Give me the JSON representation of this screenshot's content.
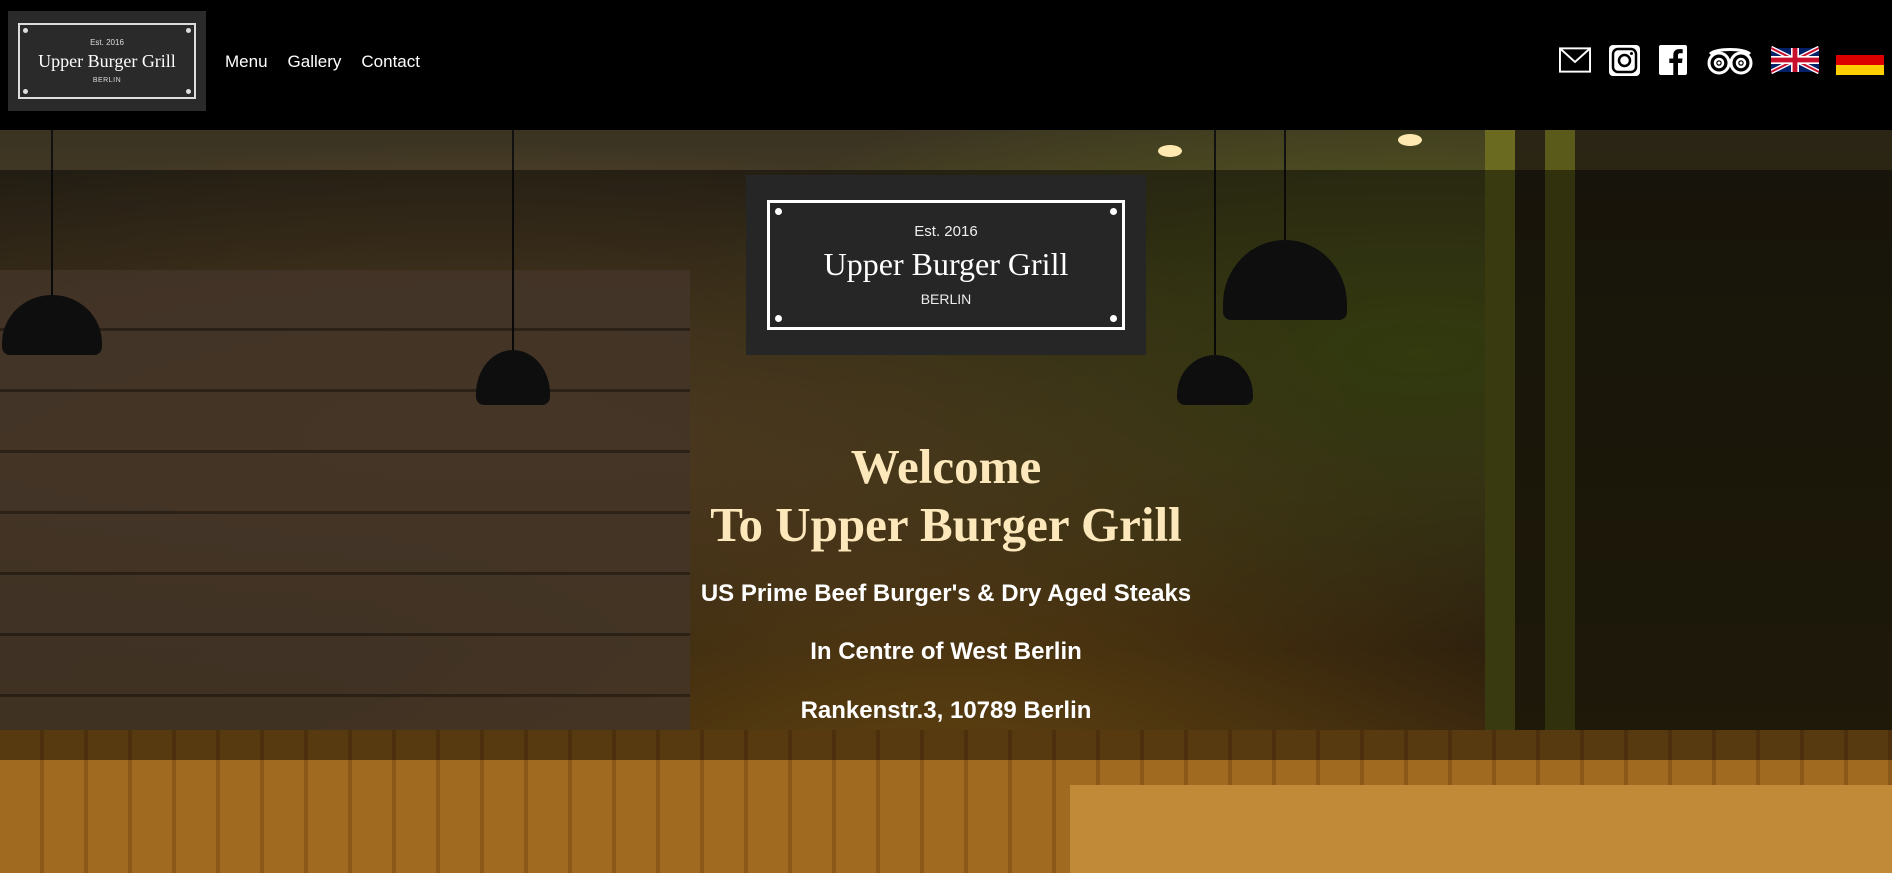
{
  "header": {
    "logo": {
      "est": "Est. 2016",
      "name": "Upper Burger Grill",
      "city": "BERLIN"
    },
    "nav": [
      {
        "label": "Menu"
      },
      {
        "label": "Gallery"
      },
      {
        "label": "Contact"
      }
    ],
    "icons": [
      "email-icon",
      "instagram-icon",
      "facebook-icon",
      "tripadvisor-icon",
      "uk-flag-icon",
      "german-flag-icon"
    ]
  },
  "hero": {
    "logo": {
      "est": "Est. 2016",
      "name": "Upper Burger Grill",
      "city": "BERLIN"
    },
    "welcome_line1": "Welcome",
    "welcome_line2": "To Upper Burger Grill",
    "tagline": "US Prime Beef Burger's & Dry Aged Steaks",
    "location": "In Centre of West Berlin",
    "address": "Rankenstr.3, 10789 Berlin"
  },
  "colors": {
    "header_bg": "#000000",
    "welcome_text": "#fde8bc",
    "logo_bg": "#262626"
  }
}
